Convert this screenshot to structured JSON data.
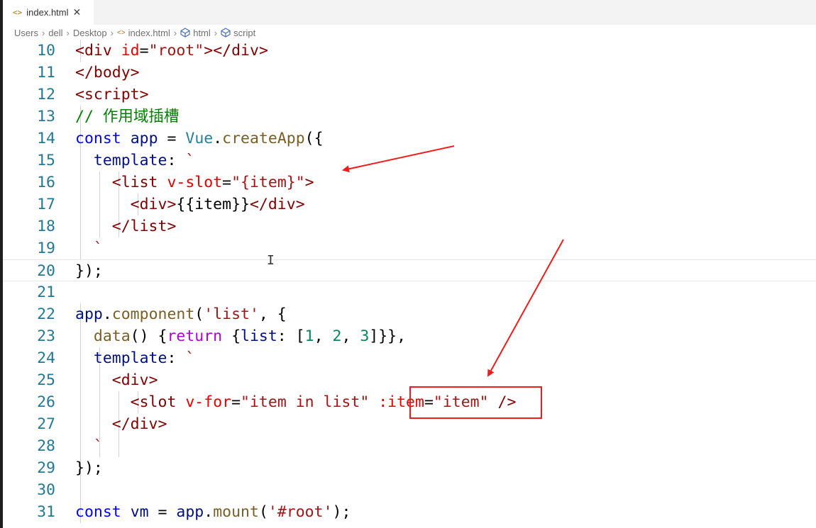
{
  "tab": {
    "icon": "html-file-icon",
    "filename": "index.html",
    "close_glyph": "✕"
  },
  "breadcrumbs": [
    "Users",
    "dell",
    "Desktop",
    "index.html",
    "html",
    "script"
  ],
  "lines": [
    {
      "num": "10",
      "text": "  <div id=\"root\"></div>"
    },
    {
      "num": "11",
      "text": "</body>"
    },
    {
      "num": "12",
      "text": "<script>"
    },
    {
      "num": "13",
      "text": "  // 作用域插槽"
    },
    {
      "num": "14",
      "text": "  const app = Vue.createApp({"
    },
    {
      "num": "15",
      "text": "    template: `"
    },
    {
      "num": "16",
      "text": "      <list v-slot=\"{item}\">"
    },
    {
      "num": "17",
      "text": "        <div>{{item}}</div>"
    },
    {
      "num": "18",
      "text": "      </list>"
    },
    {
      "num": "19",
      "text": "    `"
    },
    {
      "num": "20",
      "text": "  });"
    },
    {
      "num": "21",
      "text": ""
    },
    {
      "num": "22",
      "text": "  app.component('list', {"
    },
    {
      "num": "23",
      "text": "    data() {return {list: [1, 2, 3]}},"
    },
    {
      "num": "24",
      "text": "    template: `"
    },
    {
      "num": "25",
      "text": "      <div>"
    },
    {
      "num": "26",
      "text": "        <slot v-for=\"item in list\" :item=\"item\" />"
    },
    {
      "num": "27",
      "text": "      </div>"
    },
    {
      "num": "28",
      "text": "    `"
    },
    {
      "num": "29",
      "text": "  });"
    },
    {
      "num": "30",
      "text": ""
    },
    {
      "num": "31",
      "text": "  const vm = app.mount('#root');"
    }
  ],
  "annotation": {
    "color": "#ee1c1c",
    "highlight_text": ":item=\"item\""
  }
}
